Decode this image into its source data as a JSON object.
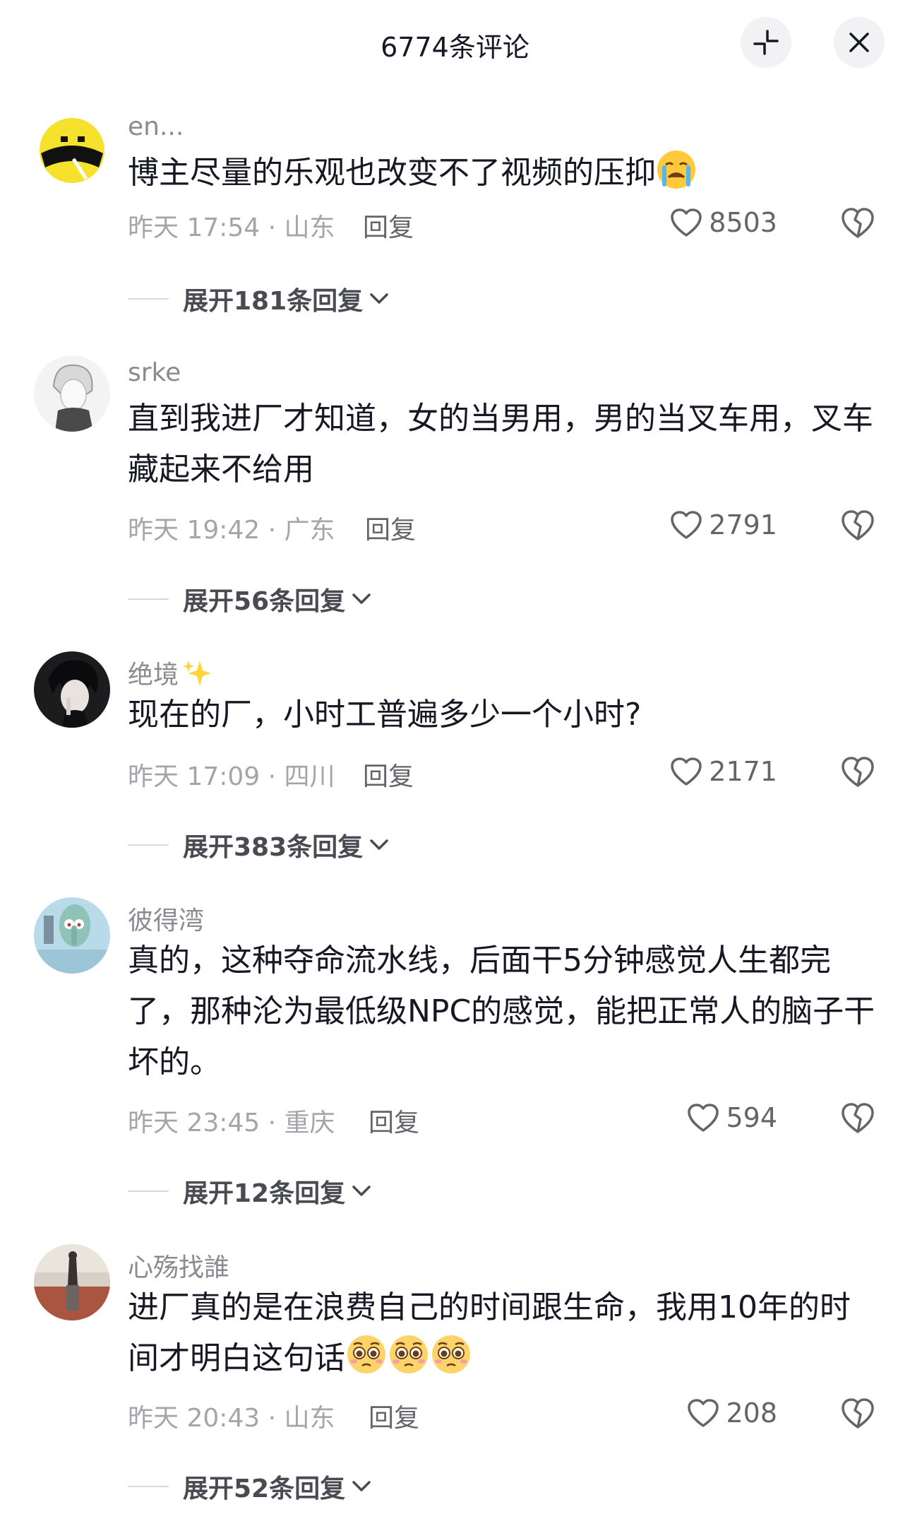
{
  "header": {
    "title": "6774条评论"
  },
  "comments": [
    {
      "username": "en...",
      "text": "博主尽量的乐观也改变不了视频的压抑",
      "emoji": "crying-emoji",
      "time_location": "昨天 17:54 · 山东",
      "reply_label": "回复",
      "likes": "8503",
      "expand_label": "展开181条回复"
    },
    {
      "username": "srke",
      "text": "直到我进厂才知道，女的当男用，男的当叉车用，叉车藏起来不给用",
      "time_location": "昨天 19:42 · 广东",
      "reply_label": "回复",
      "likes": "2791",
      "expand_label": "展开56条回复"
    },
    {
      "username": "绝境",
      "username_icon": "sparkle-icon",
      "text": "现在的厂，小时工普遍多少一个小时?",
      "time_location": "昨天 17:09 · 四川",
      "reply_label": "回复",
      "likes": "2171",
      "expand_label": "展开383条回复"
    },
    {
      "username": "彼得湾",
      "text": "真的，这种夺命流水线，后面干5分钟感觉人生都完了，那种沦为最低级NPC的感觉，能把正常人的脑子干坏的。",
      "time_location": "昨天 23:45 · 重庆",
      "reply_label": "回复",
      "likes": "594",
      "expand_label": "展开12条回复"
    },
    {
      "username": "心殇找誰",
      "text": "进厂真的是在浪费自己的时间跟生命，我用10年的时间才明白这句话",
      "emoji": "pleading-face-emoji",
      "time_location": "昨天 20:43 · 山东",
      "reply_label": "回复",
      "likes": "208",
      "expand_label": "展开52条回复"
    }
  ]
}
